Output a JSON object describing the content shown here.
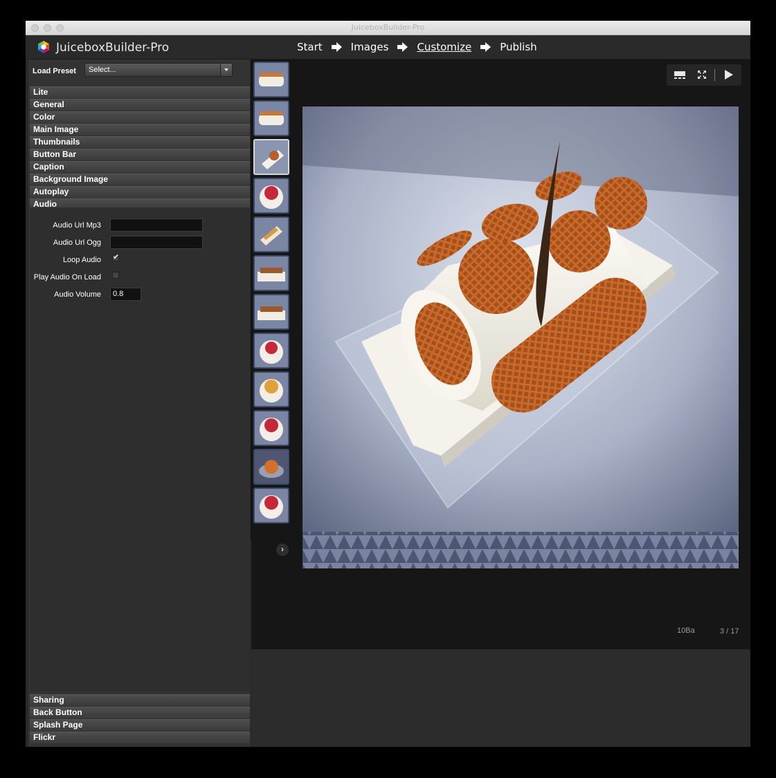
{
  "window": {
    "title": "JuiceboxBuilder-Pro"
  },
  "app": {
    "name": "JuiceboxBuilder-Pro"
  },
  "steps": [
    {
      "label": "Start",
      "active": false
    },
    {
      "label": "Images",
      "active": false
    },
    {
      "label": "Customize",
      "active": true
    },
    {
      "label": "Publish",
      "active": false
    }
  ],
  "preset": {
    "label": "Load Preset",
    "value": "Select..."
  },
  "sections": [
    "Lite",
    "General",
    "Color",
    "Main Image",
    "Thumbnails",
    "Button Bar",
    "Caption",
    "Background Image",
    "Autoplay",
    "Audio"
  ],
  "audio": {
    "url_mp3_label": "Audio Url Mp3",
    "url_mp3_value": "",
    "url_ogg_label": "Audio Url Ogg",
    "url_ogg_value": "",
    "loop_label": "Loop Audio",
    "loop_checked": true,
    "play_on_load_label": "Play Audio On Load",
    "play_on_load_checked": false,
    "volume_label": "Audio Volume",
    "volume_value": "0.8"
  },
  "bottom_sections": [
    "Sharing",
    "Back Button",
    "Splash Page",
    "Flickr"
  ],
  "viewer": {
    "tools": [
      "thumbnails-toggle-icon",
      "expand-icon",
      "play-icon"
    ],
    "image_title": "10Ba",
    "counter": "3 / 17"
  },
  "thumbnails": [
    "log-cake",
    "log-cake",
    "log-cake-selected",
    "berry-cake",
    "log-cake",
    "log-cake",
    "log-cake",
    "berry-cake",
    "fruit-cake",
    "berry-cake",
    "fruit-cake",
    "berry-cake"
  ],
  "colors": {
    "accent": "#3d4a66",
    "panel": "#333333",
    "viewer": "#161616"
  }
}
